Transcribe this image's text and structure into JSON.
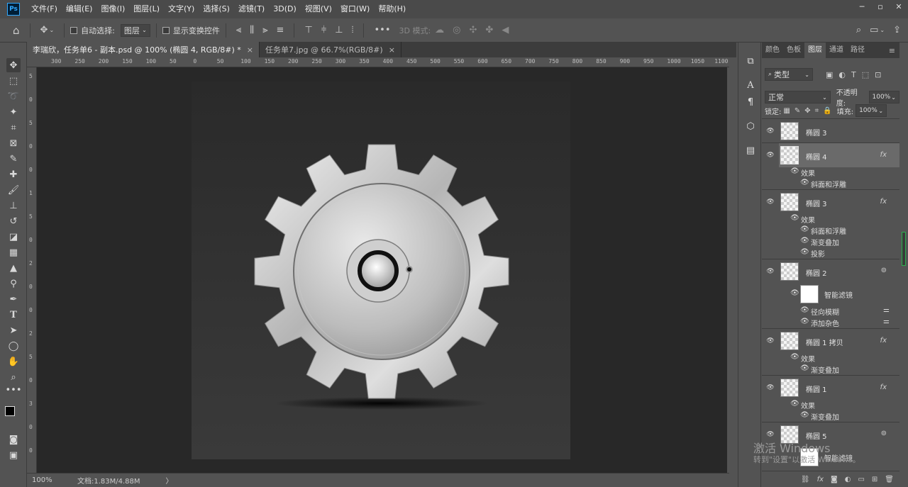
{
  "menubar": {
    "logo": "Ps",
    "items": [
      "文件(F)",
      "编辑(E)",
      "图像(I)",
      "图层(L)",
      "文字(Y)",
      "选择(S)",
      "滤镜(T)",
      "3D(D)",
      "视图(V)",
      "窗口(W)",
      "帮助(H)"
    ]
  },
  "optbar": {
    "auto_select_label": "自动选择:",
    "auto_select_value": "图层",
    "show_transform_label": "显示变换控件",
    "mode_3d_label": "3D 模式:"
  },
  "tabs": [
    {
      "label": "李瑞欣，任务单6 - 副本.psd @ 100% (椭圆 4, RGB/8#) *",
      "close": "×"
    },
    {
      "label": "任务单7.jpg @ 66.7%(RGB/8#)",
      "close": "×"
    }
  ],
  "ruler": {
    "top": [
      "300",
      "250",
      "200",
      "150",
      "100",
      "50",
      "0",
      "50",
      "100",
      "150",
      "200",
      "250",
      "300",
      "350",
      "400",
      "450",
      "500",
      "550",
      "600",
      "650",
      "700",
      "750",
      "800",
      "850",
      "900",
      "950",
      "1000",
      "1050",
      "1100"
    ],
    "left": [
      "5",
      "0",
      "5",
      "0",
      "0",
      "1",
      "5",
      "0",
      "2",
      "0",
      "0",
      "2",
      "5",
      "0",
      "3",
      "0",
      "0"
    ]
  },
  "status": {
    "zoom": "100%",
    "doc": "文档:1.83M/4.88M",
    "arrow": "〉"
  },
  "panel": {
    "tabs": [
      "颜色",
      "色板",
      "图层",
      "通道",
      "路径"
    ],
    "filter": "类型",
    "blend": "正常",
    "opacity_label": "不透明度:",
    "opacity": "100%",
    "lock_label": "锁定:",
    "fill_label": "填充:",
    "fill": "100%",
    "layers": [
      {
        "name": "椭圆 3",
        "fx": false
      },
      {
        "name": "椭圆 4",
        "fx": true,
        "effects_label": "效果",
        "effects": [
          "斜面和浮雕"
        ]
      },
      {
        "name": "椭圆 3",
        "fx": true,
        "effects_label": "效果",
        "effects": [
          "斜面和浮雕",
          "渐变叠加",
          "投影"
        ]
      },
      {
        "name": "椭圆 2",
        "smart": "智能滤镜",
        "filters": [
          "径向模糊",
          "添加杂色"
        ]
      },
      {
        "name": "椭圆 1 拷贝",
        "fx": true,
        "effects_label": "效果",
        "effects": [
          "渐变叠加"
        ]
      },
      {
        "name": "椭圆 1",
        "fx": true,
        "effects_label": "效果",
        "effects": [
          "渐变叠加"
        ]
      },
      {
        "name": "椭圆 5",
        "smart": "智能滤镜"
      }
    ],
    "fx_symbol": "fx"
  },
  "watermark": {
    "line1": "激活 Windows",
    "line2": "转到\"设置\"以激活 Windows。"
  }
}
